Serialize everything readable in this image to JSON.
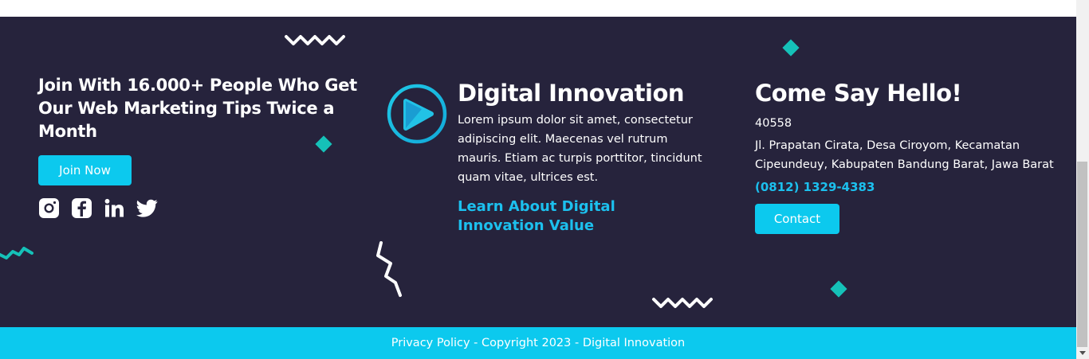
{
  "newsletter": {
    "heading": "Join With 16.000+ People Who Get Our Web Marketing Tips Twice a Month",
    "join_label": "Join Now"
  },
  "socials": [
    {
      "icon": "instagram-icon"
    },
    {
      "icon": "facebook-icon"
    },
    {
      "icon": "linkedin-icon"
    },
    {
      "icon": "twitter-icon"
    }
  ],
  "about": {
    "title": "Digital Innovation",
    "description": "Lorem ipsum dolor sit amet, consectetur adipiscing elit. Maecenas vel rutrum mauris. Etiam ac turpis porttitor, tincidunt quam vitae, ultrices est.",
    "link_label": "Learn About Digital Innovation Value"
  },
  "contact": {
    "title": "Come Say Hello!",
    "postal_code": "40558",
    "address": "Jl. Prapatan Cirata, Desa Ciroyom, Kecamatan Cipeundeuy, Kabupaten Bandung Barat, Jawa Barat",
    "phone": "(0812) 1329-4383",
    "button_label": "Contact"
  },
  "footer": {
    "copyright": "Privacy Policy - Copyright 2023 - Digital Innovation"
  },
  "colors": {
    "background": "#26233c",
    "accent": "#0cc9ee",
    "link": "#1cc0ee",
    "decor_teal": "#15c1b8"
  }
}
